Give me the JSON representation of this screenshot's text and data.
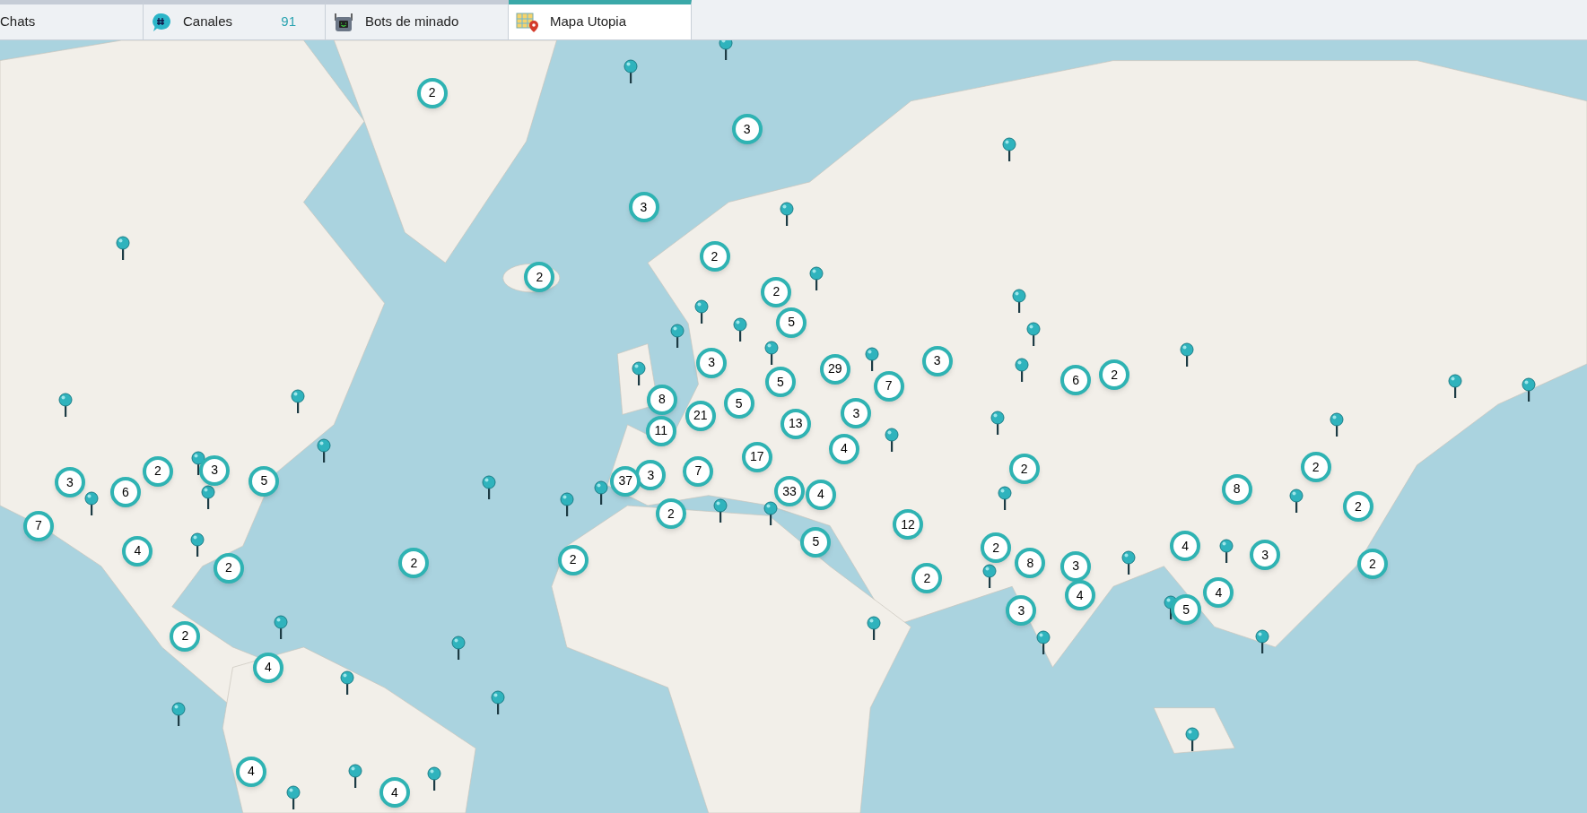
{
  "tabs": [
    {
      "label": "Chats",
      "kind": "chat",
      "selected": false
    },
    {
      "label": "Canales",
      "kind": "channel",
      "count": "91",
      "selected": false
    },
    {
      "label": "Bots de minado",
      "kind": "bot",
      "selected": false
    },
    {
      "label": "Mapa Utopia",
      "kind": "map",
      "selected": true
    }
  ],
  "map": {
    "clusters": [
      {
        "count": "2"
      },
      {
        "count": "3"
      },
      {
        "count": "3"
      },
      {
        "count": "2"
      },
      {
        "count": "2"
      },
      {
        "count": "2"
      },
      {
        "count": "5"
      },
      {
        "count": "3"
      },
      {
        "count": "5"
      },
      {
        "count": "29"
      },
      {
        "count": "7"
      },
      {
        "count": "3"
      },
      {
        "count": "8"
      },
      {
        "count": "21"
      },
      {
        "count": "5"
      },
      {
        "count": "13"
      },
      {
        "count": "3"
      },
      {
        "count": "11"
      },
      {
        "count": "4"
      },
      {
        "count": "17"
      },
      {
        "count": "7"
      },
      {
        "count": "3"
      },
      {
        "count": "37"
      },
      {
        "count": "33"
      },
      {
        "count": "4"
      },
      {
        "count": "2"
      },
      {
        "count": "12"
      },
      {
        "count": "5"
      },
      {
        "count": "2"
      },
      {
        "count": "2"
      },
      {
        "count": "2"
      },
      {
        "count": "2"
      },
      {
        "count": "8"
      },
      {
        "count": "3"
      },
      {
        "count": "4"
      },
      {
        "count": "3"
      },
      {
        "count": "2"
      },
      {
        "count": "6"
      },
      {
        "count": "2"
      },
      {
        "count": "8"
      },
      {
        "count": "2"
      },
      {
        "count": "2"
      },
      {
        "count": "4"
      },
      {
        "count": "3"
      },
      {
        "count": "2"
      },
      {
        "count": "4"
      },
      {
        "count": "5"
      },
      {
        "count": "3"
      },
      {
        "count": "6"
      },
      {
        "count": "2"
      },
      {
        "count": "3"
      },
      {
        "count": "5"
      },
      {
        "count": "7"
      },
      {
        "count": "4"
      },
      {
        "count": "2"
      },
      {
        "count": "2"
      },
      {
        "count": "4"
      },
      {
        "count": "4"
      },
      {
        "count": "4"
      }
    ]
  }
}
